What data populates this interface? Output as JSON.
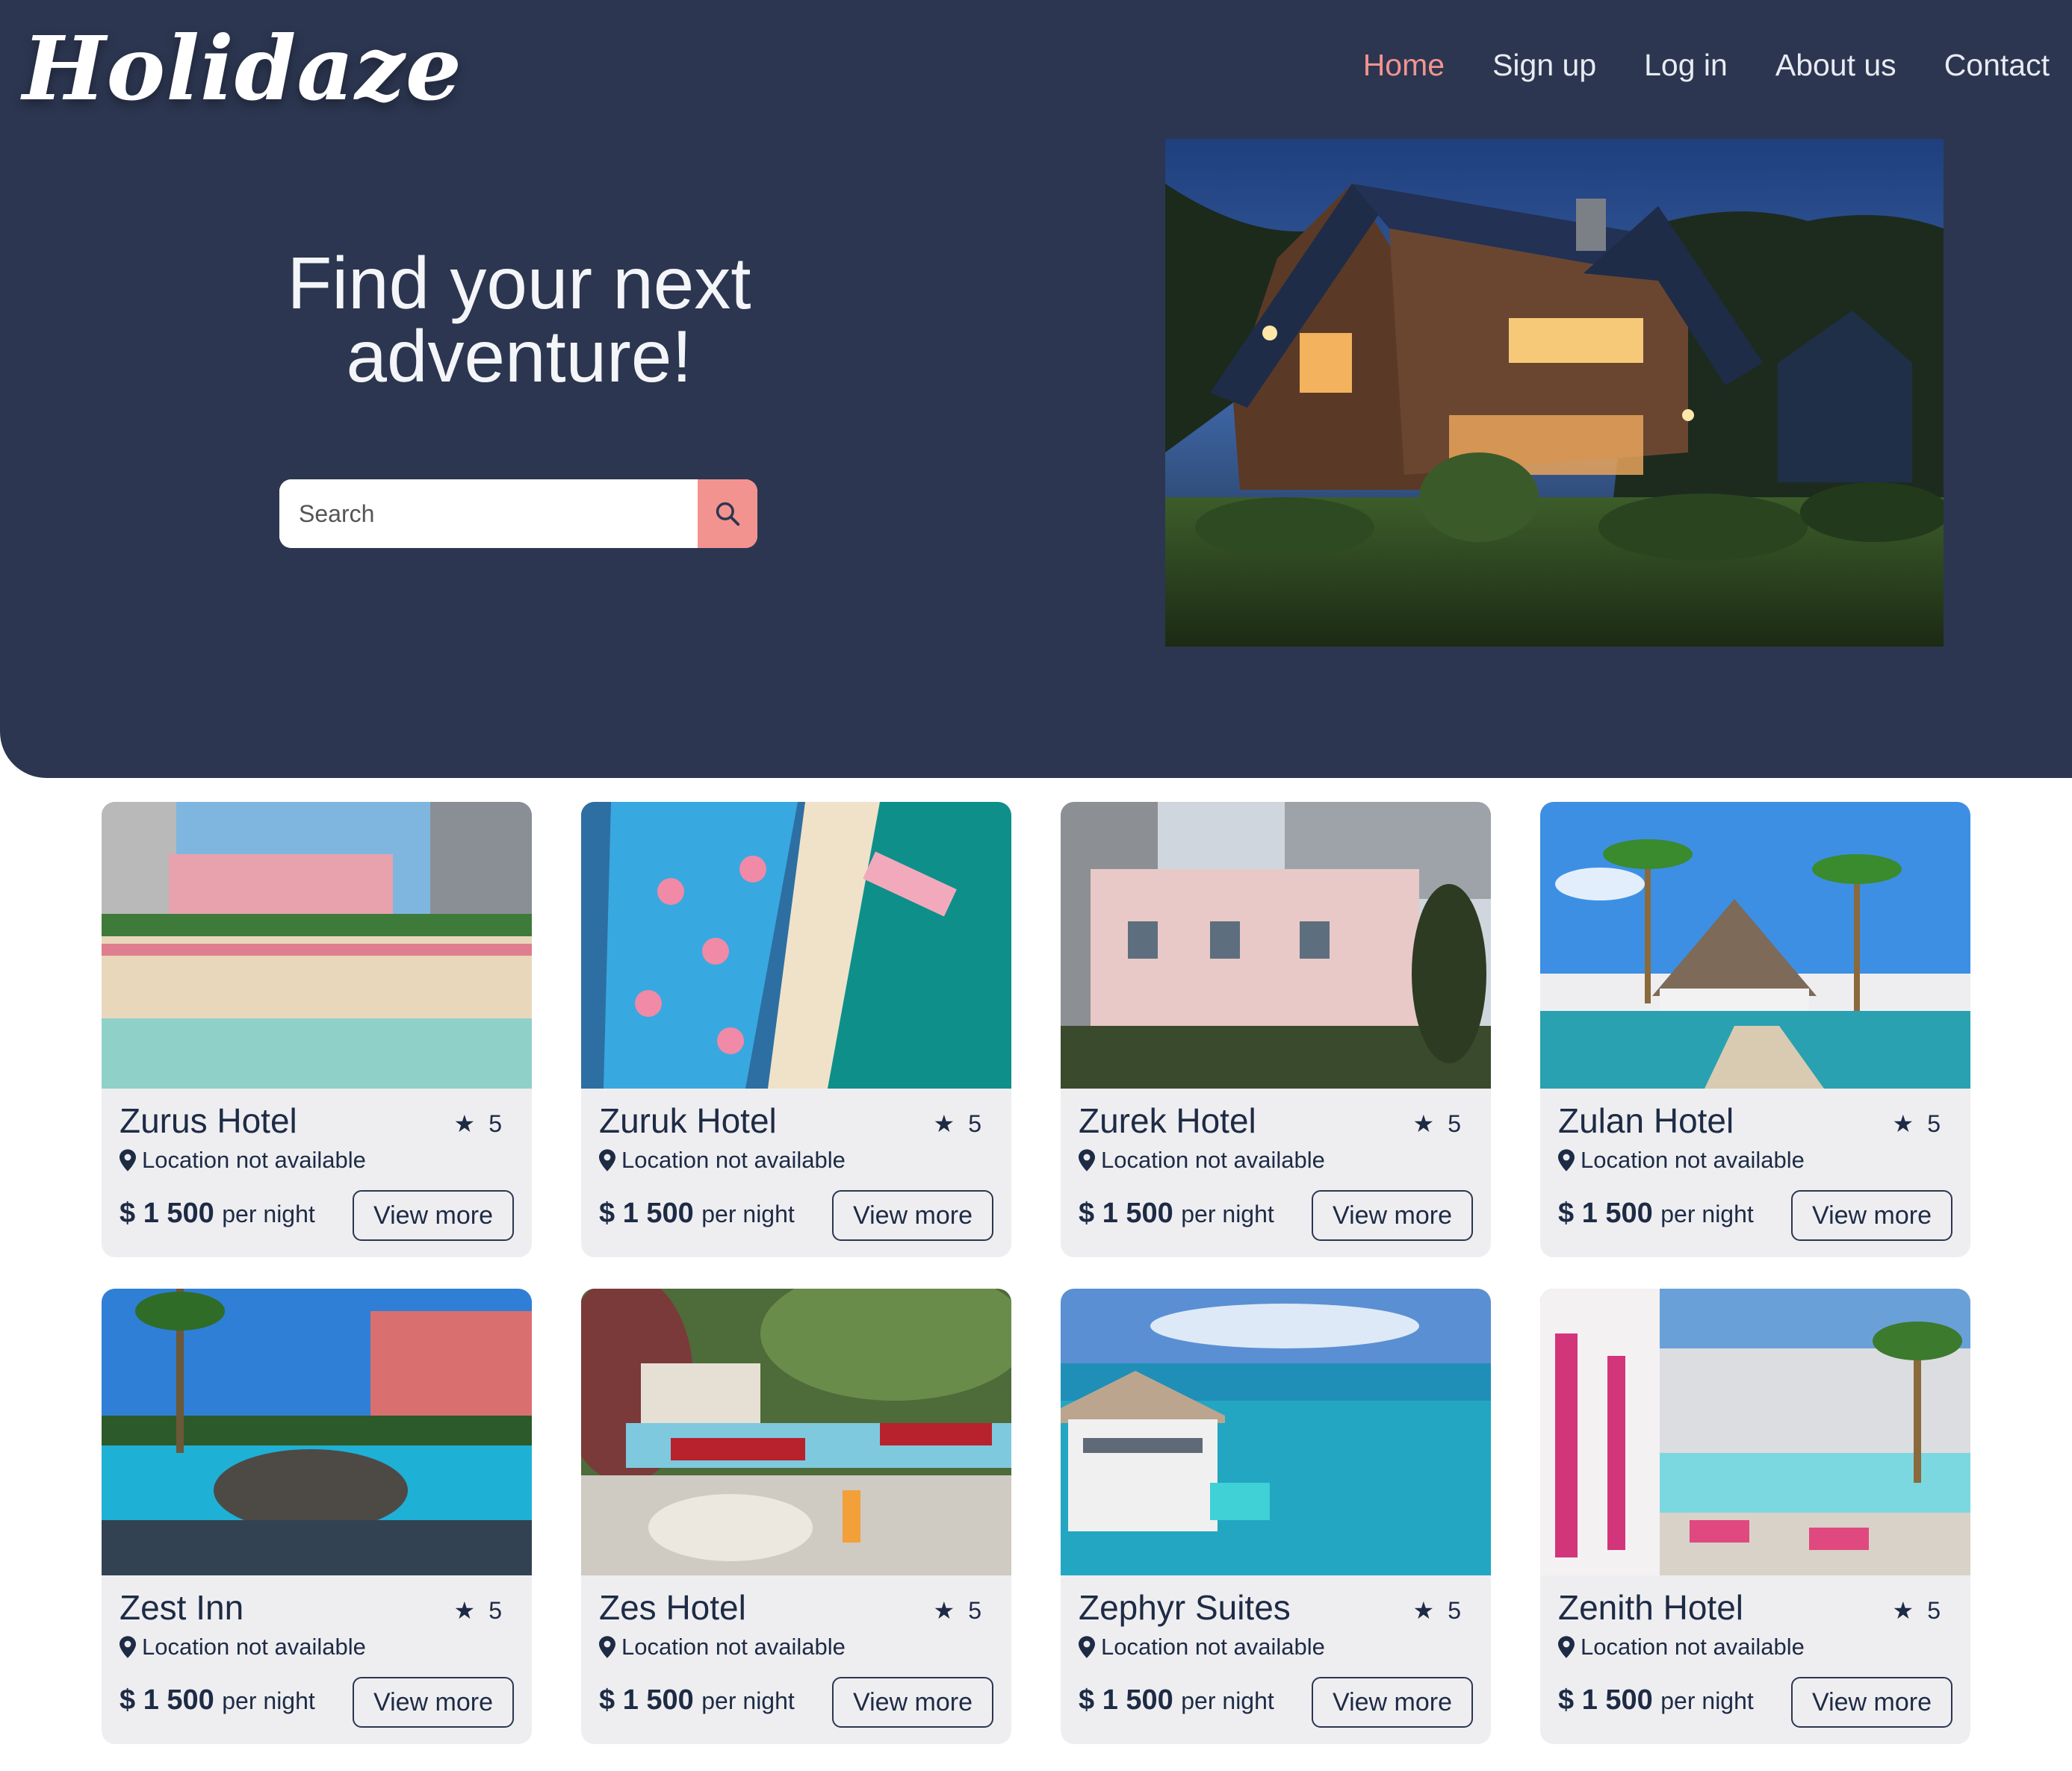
{
  "header": {
    "logo_text": "Holidaze",
    "nav": [
      {
        "label": "Home",
        "active": true
      },
      {
        "label": "Sign up",
        "active": false
      },
      {
        "label": "Log in",
        "active": false
      },
      {
        "label": "About us",
        "active": false
      },
      {
        "label": "Contact",
        "active": false
      }
    ]
  },
  "hero": {
    "title_line1": "Find your next",
    "title_line2": "adventure!",
    "search_placeholder": "Search",
    "search_icon": "search-icon",
    "image": "house-at-dusk"
  },
  "colors": {
    "navy": "#2c3650",
    "accent": "#f2938f",
    "card_bg": "#eeeef1"
  },
  "hotels": [
    {
      "name": "Zurus Hotel",
      "rating": "5",
      "location": "Location not available",
      "price": "$ 1 500",
      "per": "per night",
      "button": "View more",
      "image": "beach-resort-pink"
    },
    {
      "name": "Zuruk Hotel",
      "rating": "5",
      "location": "Location not available",
      "price": "$ 1 500",
      "per": "per night",
      "button": "View more",
      "image": "aerial-pool-resort"
    },
    {
      "name": "Zurek Hotel",
      "rating": "5",
      "location": "Location not available",
      "price": "$ 1 500",
      "per": "per night",
      "button": "View more",
      "image": "pink-facade-hotel"
    },
    {
      "name": "Zulan Hotel",
      "rating": "5",
      "location": "Location not available",
      "price": "$ 1 500",
      "per": "per night",
      "button": "View more",
      "image": "tropical-pavilion"
    },
    {
      "name": "Zest Inn",
      "rating": "5",
      "location": "Location not available",
      "price": "$ 1 500",
      "per": "per night",
      "button": "View more",
      "image": "lagoon-castle"
    },
    {
      "name": "Zes Hotel",
      "rating": "5",
      "location": "Location not available",
      "price": "$ 1 500",
      "per": "per night",
      "button": "View more",
      "image": "poolside-breakfast"
    },
    {
      "name": "Zephyr Suites",
      "rating": "5",
      "location": "Location not available",
      "price": "$ 1 500",
      "per": "per night",
      "button": "View more",
      "image": "overwater-villa"
    },
    {
      "name": "Zenith Hotel",
      "rating": "5",
      "location": "Location not available",
      "price": "$ 1 500",
      "per": "per night",
      "button": "View more",
      "image": "pink-pool-terrace"
    }
  ]
}
